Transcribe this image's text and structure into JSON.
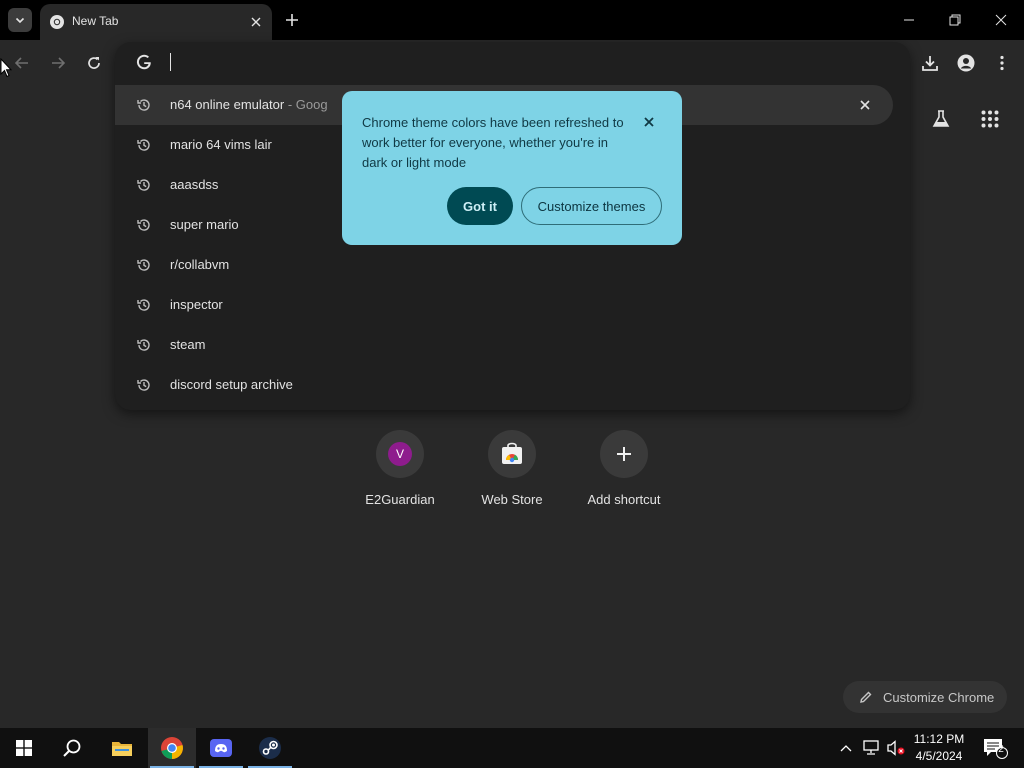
{
  "browser": {
    "tab": {
      "title": "New Tab"
    },
    "window_controls": [
      "minimize",
      "restore",
      "close"
    ]
  },
  "omnibox": {
    "value": "",
    "suggestions": [
      {
        "text": "n64 online emulator",
        "suffix": " - Goog",
        "icon": "history-icon",
        "selected": true
      },
      {
        "text": "mario 64 vims lair",
        "icon": "history-icon"
      },
      {
        "text": "aaasdss",
        "icon": "history-icon"
      },
      {
        "text": "super mario",
        "icon": "history-icon"
      },
      {
        "text": "r/collabvm",
        "icon": "history-icon"
      },
      {
        "text": "inspector",
        "icon": "history-icon"
      },
      {
        "text": "steam",
        "icon": "history-icon"
      },
      {
        "text": "discord setup archive",
        "icon": "history-icon"
      }
    ]
  },
  "theme_bubble": {
    "message": "Chrome theme colors have been refreshed to work better for everyone, whether you're in dark or light mode",
    "got_it_label": "Got it",
    "customize_label": "Customize themes"
  },
  "shortcuts": [
    {
      "label": "E2Guardian",
      "initial": "V",
      "icon": "avatar-letter"
    },
    {
      "label": "Web Store",
      "icon": "web-store-icon"
    },
    {
      "label": "Add shortcut",
      "icon": "plus-icon"
    }
  ],
  "customize_chrome": {
    "label": "Customize Chrome"
  },
  "taskbar": {
    "apps": [
      "start",
      "search",
      "file-explorer",
      "chrome",
      "discord",
      "steam"
    ],
    "active_app": "chrome",
    "clock": {
      "time": "11:12 PM",
      "date": "4/5/2024"
    },
    "notification_count": "2"
  },
  "colors": {
    "page_bg": "#282828",
    "omnibox_bg": "#1f1f1f",
    "bubble_bg": "#7ed3e6",
    "got_it_bg": "#004a53",
    "avatar_bg": "#8e1c8d"
  }
}
